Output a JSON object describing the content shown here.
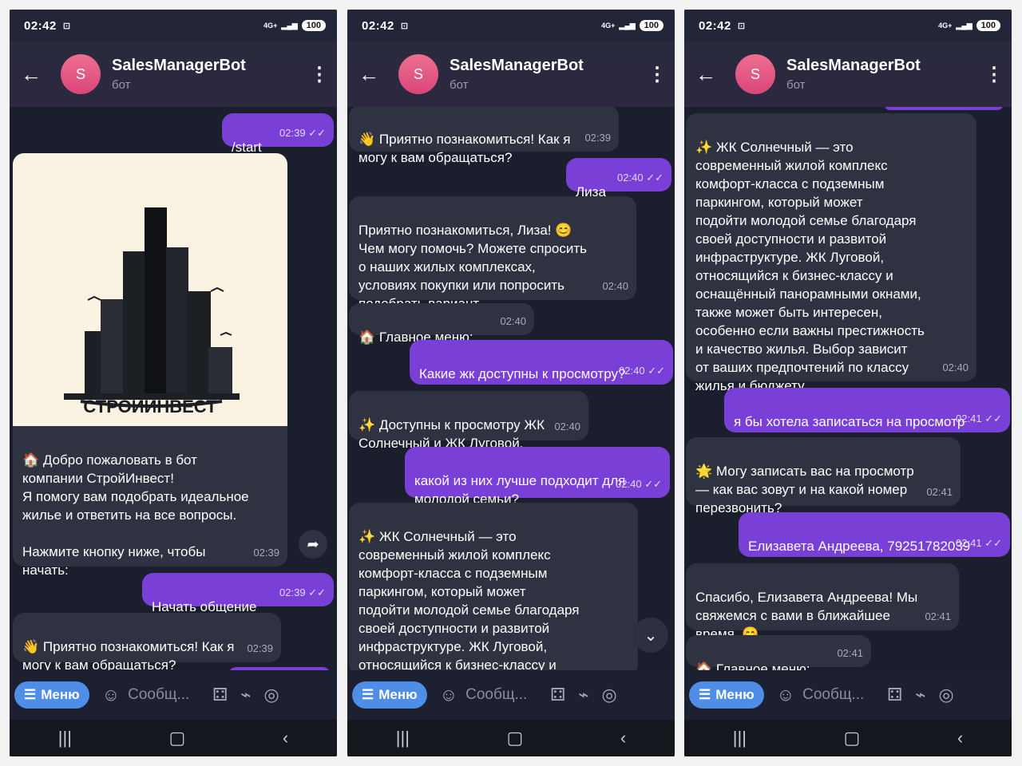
{
  "status": {
    "time": "02:42",
    "signal": "4G+",
    "battery": "100"
  },
  "chat": {
    "title": "SalesManagerBot",
    "subtitle": "бот",
    "avatar_letter": "S"
  },
  "composer": {
    "menu_label": "Меню",
    "placeholder": "Сообщ..."
  },
  "screens": [
    {
      "messages": [
        {
          "id": "m1",
          "side": "out",
          "text": "/start",
          "time": "02:39"
        },
        {
          "id": "m2",
          "side": "in",
          "image_caption": "СТРОЙИНВЕСТ"
        },
        {
          "id": "m3",
          "side": "in",
          "text": "🏠 Добро пожаловать в бот\nкомпании СтройИнвест!\nЯ помогу вам подобрать идеальное\nжилье и ответить на все вопросы.\n\nНажмите кнопку ниже, чтобы\nначать:",
          "time": "02:39"
        },
        {
          "id": "m4",
          "side": "out",
          "text": "Начать общение",
          "time": "02:39"
        },
        {
          "id": "m5",
          "side": "in",
          "text": "👋 Приятно познакомиться! Как я\nмогу к вам обращаться?",
          "time": "02:39"
        }
      ]
    },
    {
      "messages": [
        {
          "id": "m1",
          "side": "in",
          "text": "👋 Приятно познакомиться! Как я\nмогу к вам обращаться?",
          "time": "02:39"
        },
        {
          "id": "m2",
          "side": "out",
          "text": "Лиза",
          "time": "02:40"
        },
        {
          "id": "m3",
          "side": "in",
          "text": "Приятно познакомиться, Лиза! 😊\nЧем могу помочь? Можете спросить\nо наших жилых комплексах,\nусловиях покупки или попросить\nподобрать вариант.",
          "time": "02:40"
        },
        {
          "id": "m4",
          "side": "in",
          "text": "🏠 Главное меню:",
          "time": "02:40"
        },
        {
          "id": "m5",
          "side": "out",
          "text": "Какие жк доступны к просмотру?",
          "time": "02:40"
        },
        {
          "id": "m6",
          "side": "in",
          "text": "✨ Доступны к просмотру ЖК\nСолнечный и ЖК Луговой.",
          "time": "02:40"
        },
        {
          "id": "m7",
          "side": "out",
          "text": "какой из них лучше подходит для\nмолодой семьи?",
          "time": "02:40"
        },
        {
          "id": "m8",
          "side": "in",
          "text": "✨ ЖК Солнечный — это\nсовременный жилой комплекс\nкомфорт-класса с подземным\nпаркингом, который может\nподойти молодой семье благодаря\nсвоей доступности и развитой\nинфраструктуре. ЖК Луговой,\nотносящийся к бизнес-классу и\nоснащённый панорамными окнами,"
        }
      ]
    },
    {
      "messages": [
        {
          "id": "m1",
          "side": "in",
          "text": "✨ ЖК Солнечный — это\nсовременный жилой комплекс\nкомфорт-класса с подземным\nпаркингом, который может\nподойти молодой семье благодаря\nсвоей доступности и развитой\nинфраструктуре. ЖК Луговой,\nотносящийся к бизнес-классу и\nоснащённый панорамными окнами,\nтакже может быть интересен,\nособенно если важны престижность\nи качество жилья. Выбор зависит\nот ваших предпочтений по классу\nжилья и бюджету.",
          "time": "02:40"
        },
        {
          "id": "m2",
          "side": "out",
          "text": "я бы хотела записаться на просмотр",
          "time": "02:41"
        },
        {
          "id": "m3",
          "side": "in",
          "text": "🌟 Могу записать вас на просмотр\n— как вас зовут и на какой номер\nперезвонить?",
          "time": "02:41"
        },
        {
          "id": "m4",
          "side": "out",
          "text": "Елизавета Андреева, 79251782039",
          "time": "02:41"
        },
        {
          "id": "m5",
          "side": "in",
          "text": "Спасибо, Елизавета Андреева! Мы\nсвяжемся с вами в ближайшее\nвремя. 😊",
          "time": "02:41"
        },
        {
          "id": "m6",
          "side": "in",
          "text": "🏠 Главное меню:",
          "time": "02:41"
        }
      ]
    }
  ]
}
